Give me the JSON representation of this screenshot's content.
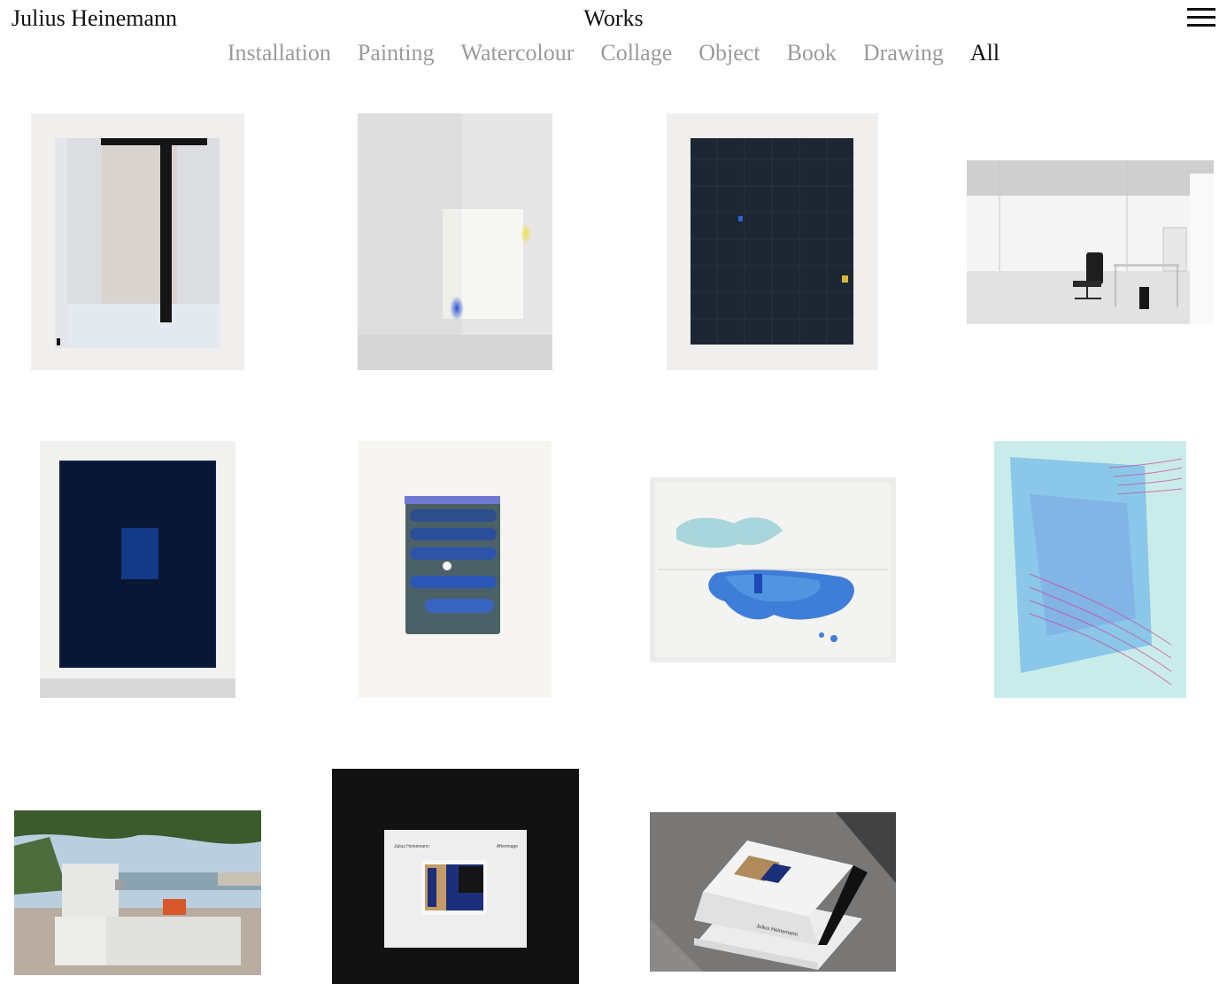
{
  "header": {
    "site_title": "Julius Heinemann",
    "page_title": "Works",
    "menu_icon": "hamburger-menu-icon"
  },
  "categories": [
    {
      "label": "Installation",
      "active": false
    },
    {
      "label": "Painting",
      "active": false
    },
    {
      "label": "Watercolour",
      "active": false
    },
    {
      "label": "Collage",
      "active": false
    },
    {
      "label": "Object",
      "active": false
    },
    {
      "label": "Book",
      "active": false
    },
    {
      "label": "Drawing",
      "active": false
    },
    {
      "label": "All",
      "active": true
    }
  ],
  "works": [
    {
      "id": "grey-painting-black-bar"
    },
    {
      "id": "grey-paper-blue-dot"
    },
    {
      "id": "dark-blue-grid-painting"
    },
    {
      "id": "office-chair-installation"
    },
    {
      "id": "dark-navy-painting"
    },
    {
      "id": "blue-stripes-watercolour"
    },
    {
      "id": "blue-cloud-watercolour"
    },
    {
      "id": "turquoise-lines-drawing"
    },
    {
      "id": "outdoor-sculpture-installation"
    },
    {
      "id": "afterimage-book-black"
    },
    {
      "id": "afterimage-book-stack"
    }
  ],
  "book": {
    "author": "Julius Heinemann",
    "title": "Afterimage"
  },
  "colors": {
    "text": "#111111",
    "nav_inactive": "#9a9a9a",
    "background": "#ffffff"
  }
}
